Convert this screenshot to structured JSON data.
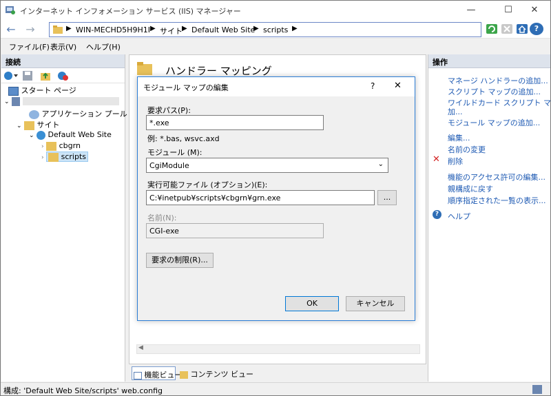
{
  "window": {
    "title": "インターネット インフォメーション サービス (IIS) マネージャー",
    "min_glyph": "—",
    "max_glyph": "☐",
    "close_glyph": "✕"
  },
  "address": {
    "back_glyph": "←",
    "forward_glyph": "→",
    "crumbs": [
      "WIN-MECHD5H9H1I",
      "サイト",
      "Default Web Site",
      "scripts"
    ],
    "sep": "▶",
    "help_glyph": "?"
  },
  "menu": [
    "ファイル(F)",
    "表示(V)",
    "ヘルプ(H)"
  ],
  "left": {
    "header": "接続",
    "tree": [
      {
        "label": "スタート ページ"
      },
      {
        "label": ""
      },
      {
        "label": "アプリケーション プール"
      },
      {
        "label": "サイト"
      },
      {
        "label": "Default Web Site"
      },
      {
        "label": "cbgrn"
      },
      {
        "label": "scripts"
      }
    ]
  },
  "center": {
    "page_title": "ハンドラー マッピング"
  },
  "right": {
    "header": "操作",
    "actions": [
      "マネージ ハンドラーの追加...",
      "スクリプト マップの追加...",
      "ワイルドカード スクリプト マップの追",
      "加...",
      "モジュール マップの追加...",
      "編集...",
      "名前の変更",
      "削除",
      "機能のアクセス許可の編集...",
      "親構成に戻す",
      "順序指定された一覧の表示...",
      "ヘルプ"
    ]
  },
  "bottom_tabs": {
    "features": "機能ビュー",
    "content": "コンテンツ ビュー"
  },
  "status": {
    "text": "構成: 'Default Web Site/scripts' web.config"
  },
  "dialog": {
    "title": "モジュール マップの編集",
    "help_glyph": "?",
    "close_glyph": "✕",
    "request_path_label": "要求パス(P):",
    "request_path_value": "*.exe",
    "request_path_example": "例: *.bas, wsvc.axd",
    "module_label": "モジュール (M):",
    "module_value": "CgiModule",
    "executable_label": "実行可能ファイル (オプション)(E):",
    "executable_value": "C:¥inetpub¥scripts¥cbgrn¥grn.exe",
    "browse_label": "...",
    "name_label": "名前(N):",
    "name_value": "CGI-exe",
    "restrictions_button": "要求の制限(R)...",
    "ok_button": "OK",
    "cancel_button": "キャンセル"
  },
  "colors": {
    "accent": "#0078d7",
    "link": "#1e5ab3",
    "panel_header": "#dde3ec"
  }
}
